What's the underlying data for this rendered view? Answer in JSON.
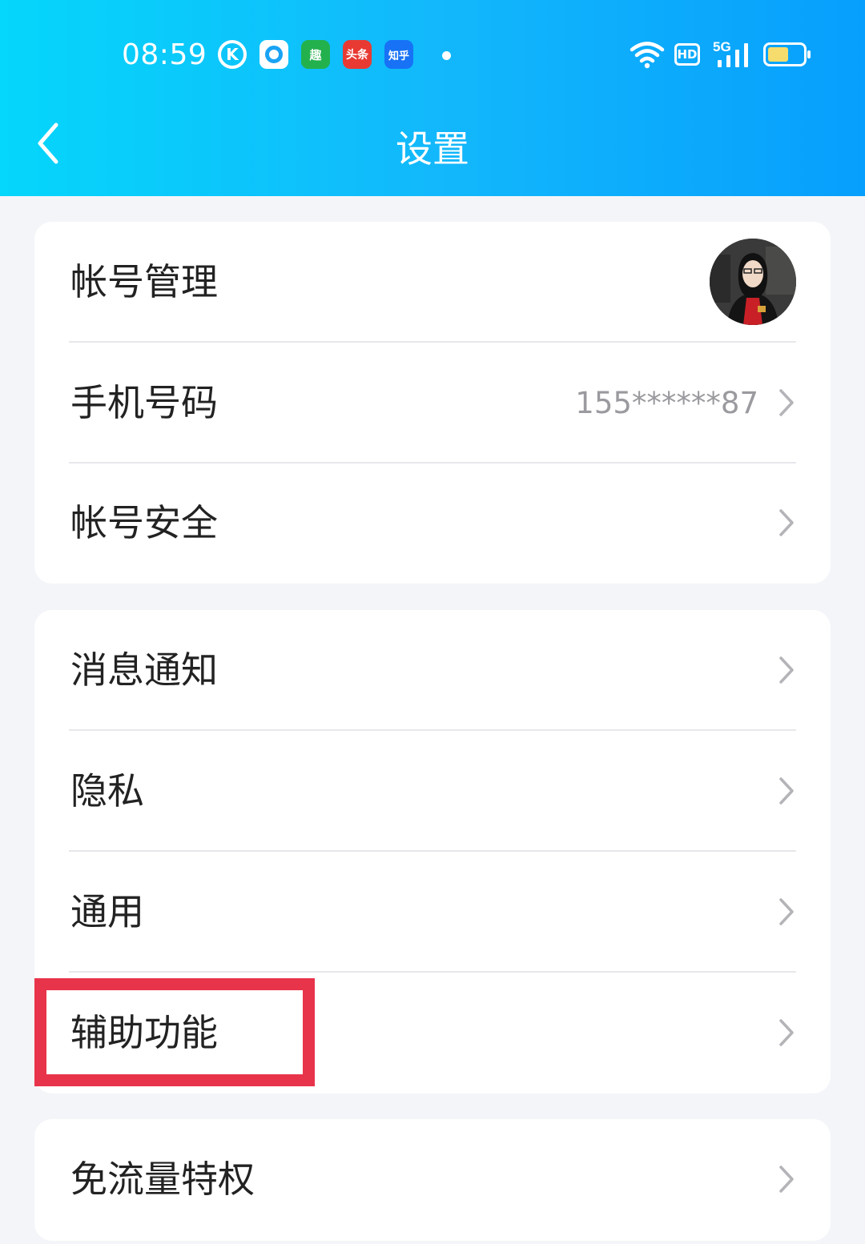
{
  "status_bar": {
    "time": "08:59",
    "notification_icons": [
      "k-app-icon",
      "browser-app-icon",
      "qutoutiao-app-icon",
      "toutiao-app-icon",
      "zhihu-app-icon"
    ],
    "notif_labels": {
      "k": "K",
      "qu": "趣",
      "toutiao": "头条",
      "zhihu": "知乎"
    },
    "hd_label": "HD",
    "network": "5G",
    "battery_level": 0.45
  },
  "header": {
    "title": "设置"
  },
  "groups": [
    {
      "rows": [
        {
          "label": "帐号管理",
          "has_avatar": true
        },
        {
          "label": "手机号码",
          "value": "155******87"
        },
        {
          "label": "帐号安全"
        }
      ]
    },
    {
      "rows": [
        {
          "label": "消息通知"
        },
        {
          "label": "隐私"
        },
        {
          "label": "通用"
        },
        {
          "label": "辅助功能",
          "highlighted": true
        }
      ]
    },
    {
      "rows": [
        {
          "label": "免流量特权"
        }
      ]
    }
  ],
  "colors": {
    "header_start": "#05d6fb",
    "header_end": "#079ffd",
    "highlight": "#e8344a",
    "background": "#f4f5f9"
  }
}
